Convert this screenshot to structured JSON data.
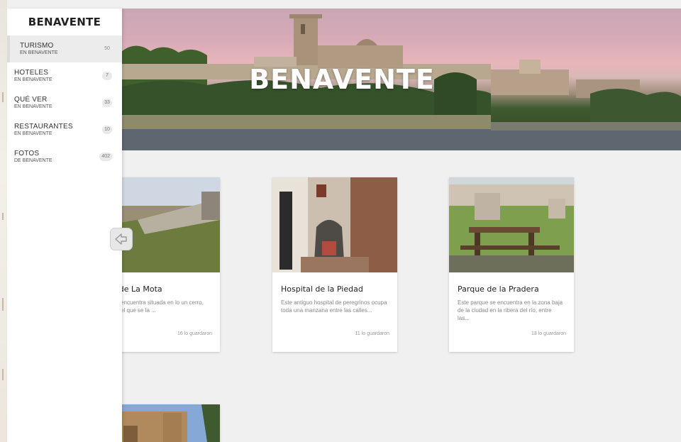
{
  "sidebar": {
    "title": "BENAVENTE",
    "items": [
      {
        "label": "TURISMO",
        "sub": "EN BENAVENTE",
        "count": "50",
        "active": true
      },
      {
        "label": "HOTELES",
        "sub": "EN BENAVENTE",
        "count": "7"
      },
      {
        "label": "QUÉ VER",
        "sub": "EN BENAVENTE",
        "count": "33"
      },
      {
        "label": "RESTAURANTES",
        "sub": "EN BENAVENTE",
        "count": "10"
      },
      {
        "label": "FOTOS",
        "sub": "DE BENAVENTE",
        "count": "402"
      }
    ]
  },
  "hero": {
    "title": "BENAVENTE"
  },
  "cards": [
    {
      "title": "dor de La Mota",
      "desc": "nte se encuentra situada en lo un cerro, desde el que se la ...",
      "saves": "16 lo guardaron"
    },
    {
      "title": "Hospital de la Piedad",
      "desc": "Este antiguo hospital de peregrinos ocupa toda una manzana entre las calles...",
      "saves": "11 lo guardaron"
    },
    {
      "title": "Parque de la Pradera",
      "desc": "Este parque se encuentra en la zona baja de la ciudad en la ribera del río, entre las...",
      "saves": "13 lo guardaron"
    }
  ],
  "icons": {
    "collapse": "arrow-left-icon"
  },
  "colors": {
    "accent": "#ececec",
    "text": "#222222"
  }
}
